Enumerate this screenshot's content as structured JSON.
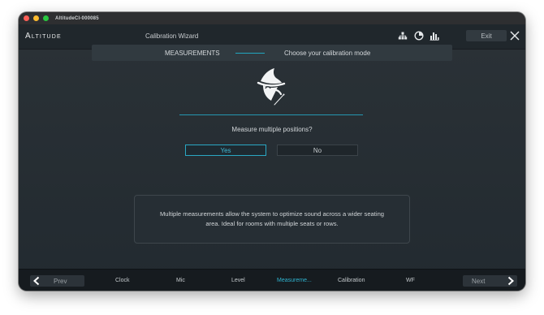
{
  "window": {
    "title": "AltitudeCI-000085"
  },
  "header": {
    "logo": "Altitude",
    "title": "Calibration Wizard",
    "exit_label": "Exit",
    "icons": [
      "network-icon",
      "speaker-icon",
      "bar-levels-icon"
    ]
  },
  "steps": {
    "left_label": "MEASUREMENTS",
    "right_label": "Choose your calibration mode"
  },
  "main": {
    "question": "Measure multiple positions?",
    "yes_label": "Yes",
    "no_label": "No",
    "info_line1": "Multiple measurements allow the system to optimize sound across a wider seating",
    "info_line2": "area. Ideal for rooms with multiple seats or rows."
  },
  "footer": {
    "prev_label": "Prev",
    "next_label": "Next",
    "steps": [
      {
        "label": "Clock",
        "active": false
      },
      {
        "label": "Mic",
        "active": false
      },
      {
        "label": "Level",
        "active": false
      },
      {
        "label": "Measureme...",
        "active": true
      },
      {
        "label": "Calibration",
        "active": false
      },
      {
        "label": "WF",
        "active": false
      }
    ]
  },
  "colors": {
    "accent": "#2fb3cf",
    "background": "#252d33"
  }
}
